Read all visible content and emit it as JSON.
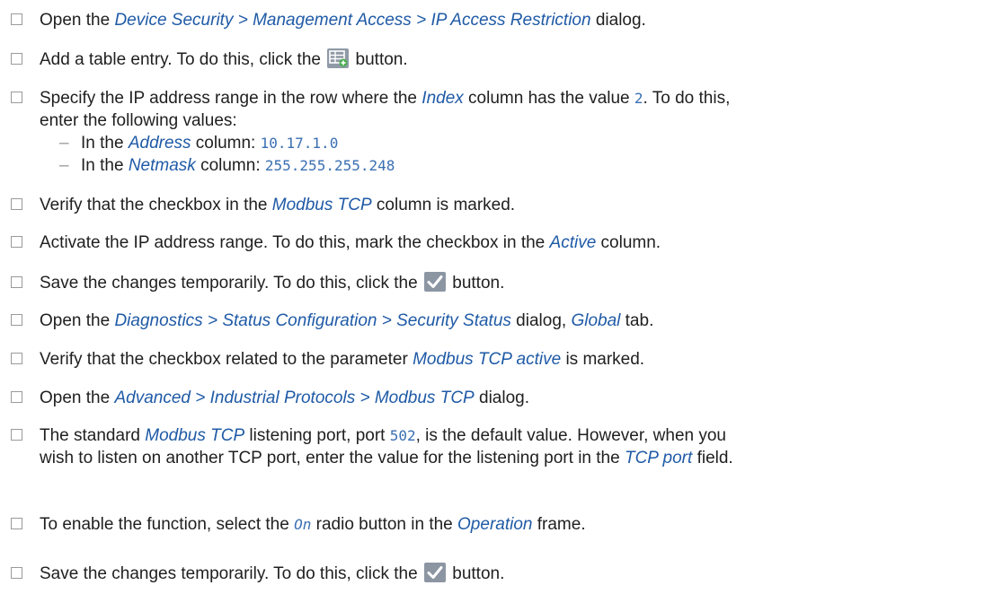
{
  "steps": [
    {
      "before": "Open the ",
      "link": "Device Security > Management Access > IP Access Restriction",
      "after": " dialog."
    },
    {
      "before": "Add a table entry. To do this, click the ",
      "icon": "add-table-entry-icon",
      "after": " button."
    },
    {
      "p1": "Specify the IP address range in the row where the ",
      "link": "Index",
      "p2": " column has the value ",
      "value": "2",
      "p3": ". To do this,",
      "line2": "enter the following values:"
    },
    {
      "sub": [
        {
          "dash": "–",
          "before": "In the ",
          "link": "Address",
          "after": " column: ",
          "value": "10.17.1.0"
        },
        {
          "dash": "–",
          "before": "In the ",
          "link": "Netmask",
          "after": " column: ",
          "value": "255.255.255.248"
        }
      ]
    },
    {
      "before": "Verify that the checkbox in the ",
      "link": "Modbus TCP",
      "after": " column is marked."
    },
    {
      "before": "Activate the IP address range. To do this, mark the checkbox in the ",
      "link": "Active",
      "after": " column."
    },
    {
      "before": "Save the changes temporarily. To do this, click the ",
      "icon": "checkmark-icon",
      "after": " button."
    },
    {
      "before": "Open the ",
      "link": "Diagnostics > Status Configuration > Security Status",
      "mid": " dialog, ",
      "link2": "Global",
      "after": " tab."
    },
    {
      "before": "Verify that the checkbox related to the parameter ",
      "link": "Modbus TCP active",
      "after": " is marked."
    },
    {
      "before": "Open the ",
      "link": "Advanced > Industrial Protocols > Modbus TCP",
      "after": " dialog."
    },
    {
      "p1": "The standard ",
      "link": "Modbus TCP",
      "p2": " listening port, port ",
      "value": "502",
      "p3": ", is the default value. However, when you",
      "line2a": "wish to listen on another TCP port, enter the value for the listening port in the ",
      "link2": "TCP port",
      "line2b": " field."
    },
    {
      "before": "To enable the function, select the ",
      "value": "On",
      "mid": " radio button in the ",
      "link": "Operation",
      "after": " frame."
    },
    {
      "before": "Save the changes temporarily. To do this, click the ",
      "icon": "checkmark-icon",
      "after": " button."
    }
  ],
  "colors": {
    "link": "#1f5aa6",
    "value": "#3a6fb2",
    "checkbox_border": "#9a9a9a",
    "button_icon": "#8c96a3"
  }
}
